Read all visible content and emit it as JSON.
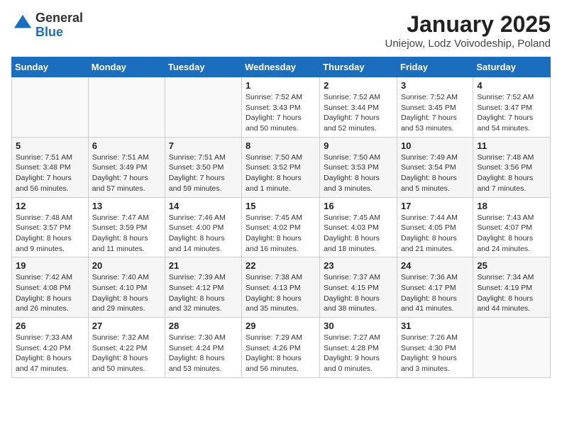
{
  "logo": {
    "general": "General",
    "blue": "Blue"
  },
  "title": "January 2025",
  "subtitle": "Uniejow, Lodz Voivodeship, Poland",
  "headers": [
    "Sunday",
    "Monday",
    "Tuesday",
    "Wednesday",
    "Thursday",
    "Friday",
    "Saturday"
  ],
  "weeks": [
    [
      {
        "day": "",
        "detail": ""
      },
      {
        "day": "",
        "detail": ""
      },
      {
        "day": "",
        "detail": ""
      },
      {
        "day": "1",
        "detail": "Sunrise: 7:52 AM\nSunset: 3:43 PM\nDaylight: 7 hours\nand 50 minutes."
      },
      {
        "day": "2",
        "detail": "Sunrise: 7:52 AM\nSunset: 3:44 PM\nDaylight: 7 hours\nand 52 minutes."
      },
      {
        "day": "3",
        "detail": "Sunrise: 7:52 AM\nSunset: 3:45 PM\nDaylight: 7 hours\nand 53 minutes."
      },
      {
        "day": "4",
        "detail": "Sunrise: 7:52 AM\nSunset: 3:47 PM\nDaylight: 7 hours\nand 54 minutes."
      }
    ],
    [
      {
        "day": "5",
        "detail": "Sunrise: 7:51 AM\nSunset: 3:48 PM\nDaylight: 7 hours\nand 56 minutes."
      },
      {
        "day": "6",
        "detail": "Sunrise: 7:51 AM\nSunset: 3:49 PM\nDaylight: 7 hours\nand 57 minutes."
      },
      {
        "day": "7",
        "detail": "Sunrise: 7:51 AM\nSunset: 3:50 PM\nDaylight: 7 hours\nand 59 minutes."
      },
      {
        "day": "8",
        "detail": "Sunrise: 7:50 AM\nSunset: 3:52 PM\nDaylight: 8 hours\nand 1 minute."
      },
      {
        "day": "9",
        "detail": "Sunrise: 7:50 AM\nSunset: 3:53 PM\nDaylight: 8 hours\nand 3 minutes."
      },
      {
        "day": "10",
        "detail": "Sunrise: 7:49 AM\nSunset: 3:54 PM\nDaylight: 8 hours\nand 5 minutes."
      },
      {
        "day": "11",
        "detail": "Sunrise: 7:48 AM\nSunset: 3:56 PM\nDaylight: 8 hours\nand 7 minutes."
      }
    ],
    [
      {
        "day": "12",
        "detail": "Sunrise: 7:48 AM\nSunset: 3:57 PM\nDaylight: 8 hours\nand 9 minutes."
      },
      {
        "day": "13",
        "detail": "Sunrise: 7:47 AM\nSunset: 3:59 PM\nDaylight: 8 hours\nand 11 minutes."
      },
      {
        "day": "14",
        "detail": "Sunrise: 7:46 AM\nSunset: 4:00 PM\nDaylight: 8 hours\nand 14 minutes."
      },
      {
        "day": "15",
        "detail": "Sunrise: 7:45 AM\nSunset: 4:02 PM\nDaylight: 8 hours\nand 16 minutes."
      },
      {
        "day": "16",
        "detail": "Sunrise: 7:45 AM\nSunset: 4:03 PM\nDaylight: 8 hours\nand 18 minutes."
      },
      {
        "day": "17",
        "detail": "Sunrise: 7:44 AM\nSunset: 4:05 PM\nDaylight: 8 hours\nand 21 minutes."
      },
      {
        "day": "18",
        "detail": "Sunrise: 7:43 AM\nSunset: 4:07 PM\nDaylight: 8 hours\nand 24 minutes."
      }
    ],
    [
      {
        "day": "19",
        "detail": "Sunrise: 7:42 AM\nSunset: 4:08 PM\nDaylight: 8 hours\nand 26 minutes."
      },
      {
        "day": "20",
        "detail": "Sunrise: 7:40 AM\nSunset: 4:10 PM\nDaylight: 8 hours\nand 29 minutes."
      },
      {
        "day": "21",
        "detail": "Sunrise: 7:39 AM\nSunset: 4:12 PM\nDaylight: 8 hours\nand 32 minutes."
      },
      {
        "day": "22",
        "detail": "Sunrise: 7:38 AM\nSunset: 4:13 PM\nDaylight: 8 hours\nand 35 minutes."
      },
      {
        "day": "23",
        "detail": "Sunrise: 7:37 AM\nSunset: 4:15 PM\nDaylight: 8 hours\nand 38 minutes."
      },
      {
        "day": "24",
        "detail": "Sunrise: 7:36 AM\nSunset: 4:17 PM\nDaylight: 8 hours\nand 41 minutes."
      },
      {
        "day": "25",
        "detail": "Sunrise: 7:34 AM\nSunset: 4:19 PM\nDaylight: 8 hours\nand 44 minutes."
      }
    ],
    [
      {
        "day": "26",
        "detail": "Sunrise: 7:33 AM\nSunset: 4:20 PM\nDaylight: 8 hours\nand 47 minutes."
      },
      {
        "day": "27",
        "detail": "Sunrise: 7:32 AM\nSunset: 4:22 PM\nDaylight: 8 hours\nand 50 minutes."
      },
      {
        "day": "28",
        "detail": "Sunrise: 7:30 AM\nSunset: 4:24 PM\nDaylight: 8 hours\nand 53 minutes."
      },
      {
        "day": "29",
        "detail": "Sunrise: 7:29 AM\nSunset: 4:26 PM\nDaylight: 8 hours\nand 56 minutes."
      },
      {
        "day": "30",
        "detail": "Sunrise: 7:27 AM\nSunset: 4:28 PM\nDaylight: 9 hours\nand 0 minutes."
      },
      {
        "day": "31",
        "detail": "Sunrise: 7:26 AM\nSunset: 4:30 PM\nDaylight: 9 hours\nand 3 minutes."
      },
      {
        "day": "",
        "detail": ""
      }
    ]
  ]
}
